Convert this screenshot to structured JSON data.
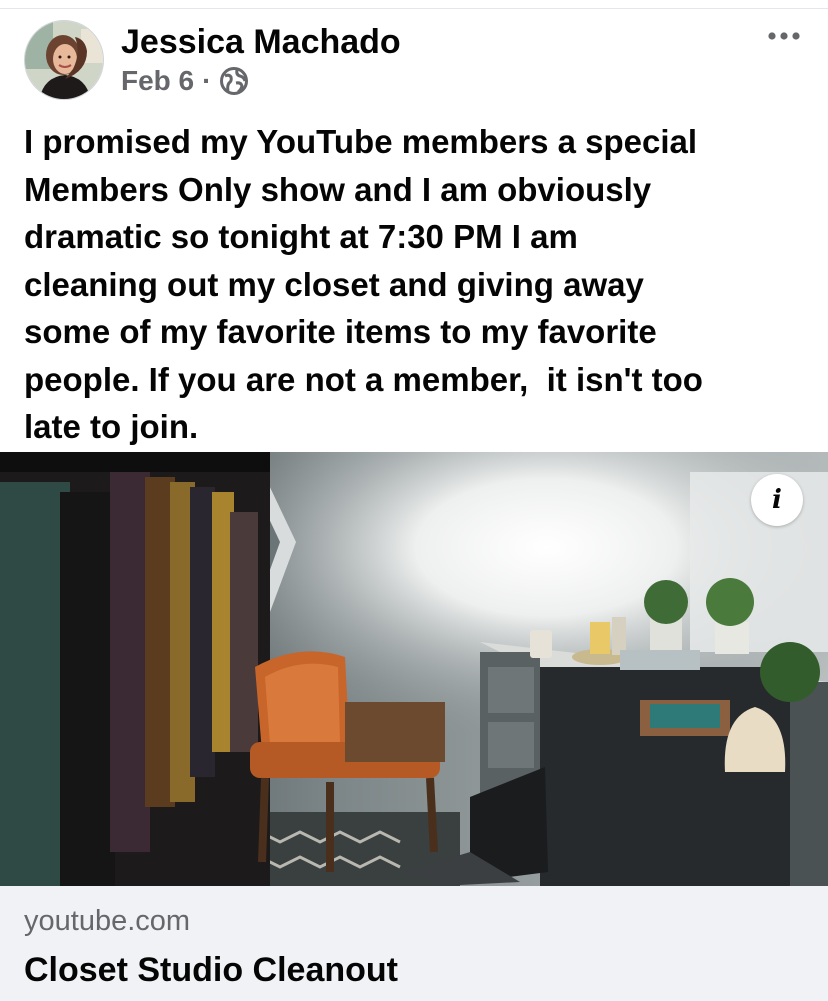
{
  "post": {
    "author": "Jessica Machado",
    "date": "Feb 6",
    "separator": "·",
    "audience_icon": "globe-icon",
    "more_icon": "more-options-icon",
    "text": "I promised my YouTube members a special\nMembers Only show and I am obviously\ndramatic so tonight at 7:30 PM I am\ncleaning out my closet and giving away\nsome of my favorite items to my favorite\npeople. If you are not a member,  it isn't too\nlate to join."
  },
  "link_preview": {
    "domain": "youtube.com",
    "title": "Closet Studio Cleanout",
    "info_glyph": "i"
  },
  "colors": {
    "primary_text": "#050505",
    "secondary_text": "#65676b",
    "card_background": "#f0f2f5"
  }
}
